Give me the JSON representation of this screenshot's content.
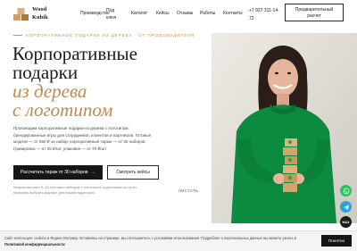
{
  "header": {
    "logo": {
      "line1": "Wood",
      "line2": "Kubik",
      "badge": "WOOD"
    },
    "nav": [
      {
        "label": "Производство"
      },
      {
        "label": "Под",
        "label2": "ключ"
      },
      {
        "label": "Каталог"
      },
      {
        "label": "Кейсы"
      },
      {
        "label": "Отзывы"
      },
      {
        "label": "Работы"
      },
      {
        "label": "Контакты"
      }
    ],
    "phone": {
      "line1": "+7 927 311-14-",
      "line2": "72"
    },
    "offer_button": {
      "line1": "Предварительный",
      "line2": "расчет"
    }
  },
  "hero": {
    "tagline": "КОРПОРАТИВНЫЕ ПОДАРКИ ИЗ ДЕРЕВА · ОТ ПРОИЗВОДИТЕЛЯ",
    "title_lines": [
      "Корпоративные",
      "подарки"
    ],
    "accent_lines": [
      "из дерева",
      "с логотипом"
    ],
    "description": "Производим корпоративные подарки из дерева с логотипом: брендированные игры для сотрудников, клиентов и партнёров. Готовые модели — от 650 ₽ за набор, корпоративный тираж — от 30 наборов. Гравировка — от 35 ₽/шт, упаковка — от 70 ₽/шт",
    "primary_button": "Рассчитать тираж от 30 наборов",
    "primary_arrow": "→",
    "secondary_button": "Смотреть кейсы",
    "note": "Можем выслать 5–10 тестовых наборов с логотипом: подготовим за сутки, поможем выбрать формат для вашей аудитории.",
    "scroll_label": "ЛИСТАТЬ"
  },
  "floating": {
    "whatsapp_icon": "whatsapp-icon",
    "telegram_icon": "telegram-icon",
    "max_label": "MAX"
  },
  "cookie": {
    "text": "Сайт использует cookies и Яндекс.Метрику. Оставаясь на странице, вы соглашаетесь с условиями использования. Подробнее о персональных данных вы можете узнать в",
    "link": "Политикой конфиденциальности",
    "button": "Понятно"
  },
  "colors": {
    "accent_gold": "#b98a52",
    "sweater_green": "#0c8a3f",
    "dark_button": "#161616"
  }
}
